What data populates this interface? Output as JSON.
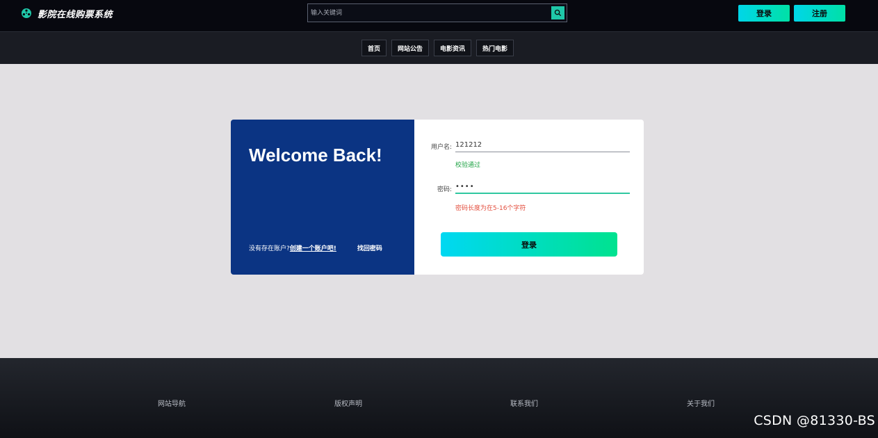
{
  "header": {
    "brand_title": "影院在线购票系统",
    "brand_icon": "film-reel-icon",
    "search_placeholder": "输入关键词",
    "search_icon": "search-icon",
    "login_label": "登录",
    "register_label": "注册",
    "accent_color": "#1fc7a8"
  },
  "nav": {
    "items": [
      {
        "label": "首页"
      },
      {
        "label": "网站公告"
      },
      {
        "label": "电影资讯"
      },
      {
        "label": "热门电影"
      }
    ]
  },
  "login_card": {
    "welcome": "Welcome Back!",
    "no_account_text": "没有存在账户?",
    "create_link": "创建一个账户吧!",
    "forgot_link": "找回密码",
    "panel_color": "#0b3483",
    "username": {
      "label": "用户名:",
      "value": "121212",
      "message": "校验通过"
    },
    "password": {
      "label": "密码:",
      "value": "1234",
      "message": "密码长度为在5-16个字符"
    },
    "submit_label": "登录"
  },
  "footer": {
    "links": [
      {
        "label": "网站导航"
      },
      {
        "label": "版权声明"
      },
      {
        "label": "联系我们"
      },
      {
        "label": "关于我们"
      }
    ],
    "watermark": "CSDN @81330-BS"
  }
}
